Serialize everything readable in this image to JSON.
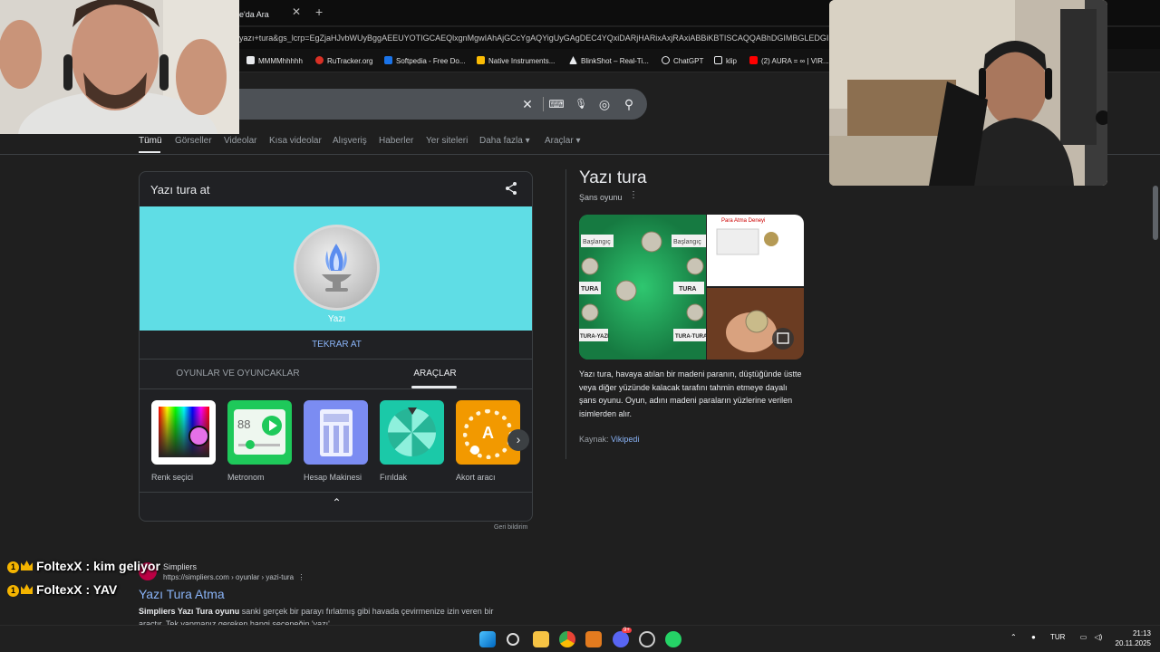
{
  "browser": {
    "tab_title": "le'da Ara",
    "tab_close": "✕",
    "tab_new": "+",
    "url": "yazı+tura&gs_lcrp=EgZjaHJvbWUyBggAEEUYOTIGCAEQlxgnMgwIAhAjGCcYgAQYigUyGAgDEC4YQxiDARjHARixAxjRAxiABBiKBTISCAQQABhDGIMBGLEDGIAEGI",
    "bookmarks": [
      {
        "label": "MMMMhhhhh",
        "icon": "bookmark-icon"
      },
      {
        "label": "RuTracker.org",
        "icon": "rutracker-icon"
      },
      {
        "label": "Softpedia - Free Do...",
        "icon": "softpedia-icon"
      },
      {
        "label": "Native Instruments...",
        "icon": "folder-icon"
      },
      {
        "label": "BlinkShot – Real-Ti...",
        "icon": "blinkshot-icon"
      },
      {
        "label": "ChatGPT",
        "icon": "chatgpt-icon"
      },
      {
        "label": "klip",
        "icon": "folder-icon"
      },
      {
        "label": "(2) AURA = ∞ | VIR...",
        "icon": "youtube-icon"
      }
    ]
  },
  "search": {
    "clear": "✕",
    "keyboard": "⌨",
    "mic": "🎙",
    "lens": "◎",
    "search": "⚲"
  },
  "nav_tabs": [
    {
      "label": "Tümü",
      "active": true
    },
    {
      "label": "Görseller"
    },
    {
      "label": "Videolar"
    },
    {
      "label": "Kısa videolar"
    },
    {
      "label": "Alışveriş"
    },
    {
      "label": "Haberler"
    },
    {
      "label": "Yer siteleri"
    },
    {
      "label": "Daha fazla ▾"
    },
    {
      "label": "Araçlar ▾"
    }
  ],
  "coin_card": {
    "title": "Yazı tura at",
    "coin_result": "Yazı",
    "flip_button": "TEKRAR AT",
    "tab_games": "OYUNLAR VE OYUNCAKLAR",
    "tab_tools": "ARAÇLAR",
    "tools": [
      {
        "label": "Renk seçici",
        "icon": "color-picker-icon"
      },
      {
        "label": "Metronom",
        "icon": "metronome-icon",
        "bpm": "88"
      },
      {
        "label": "Hesap Makinesi",
        "icon": "calculator-icon"
      },
      {
        "label": "Fırıldak",
        "icon": "spinner-icon"
      },
      {
        "label": "Akort aracı",
        "icon": "tuner-icon",
        "letter": "A"
      }
    ],
    "next": "›",
    "collapse": "⌃",
    "feedback": "Geri bildirim"
  },
  "knowledge_panel": {
    "title": "Yazı tura",
    "subtitle": "Şans oyunu",
    "more": "⋮",
    "description": "Yazı tura, havaya atılan bir madeni paranın, düştüğünde üstte veya diğer yüzünde kalacak tarafını tahmin etmeye dayalı şans oyunu. Oyun, adını madeni paraların yüzlerine verilen isimlerden alır.",
    "source_label": "Kaynak:",
    "source_link": "Vikipedi",
    "image_labels": {
      "start1": "Başlangıç",
      "start2": "Başlangıç",
      "tura1": "TURA",
      "tura2": "TURA",
      "turayazi": "TURA-YAZI",
      "turatura": "TURA-TURA",
      "experiment": "Para Atma Deneyi"
    }
  },
  "result": {
    "site": "Simpliers",
    "url": "https://simpliers.com › oyunlar › yazi-tura",
    "more": "⋮",
    "title": "Yazı Tura Atma",
    "snippet_bold": "Simpliers Yazı Tura oyunu",
    "snippet": " sanki gerçek bir parayı fırlatmış gibi havada çevirmenize izin veren bir araçtır. Tek yapmanız gereken hangi seçeneğin 'yazı'"
  },
  "chat": [
    {
      "badge": "1",
      "user": "FoltexX",
      "message": " : kim geliyor"
    },
    {
      "badge": "1",
      "user": "FoltexX",
      "message": " : YAV"
    }
  ],
  "taskbar": {
    "lang": "TUR",
    "time": "21:13",
    "date": "20.11.2025",
    "discord_badge": "9+",
    "tray_up": "⌃"
  },
  "colors": {
    "coin_bg": "#5fdde5",
    "link": "#8ab4f8",
    "page_bg": "#1f1f1f"
  }
}
